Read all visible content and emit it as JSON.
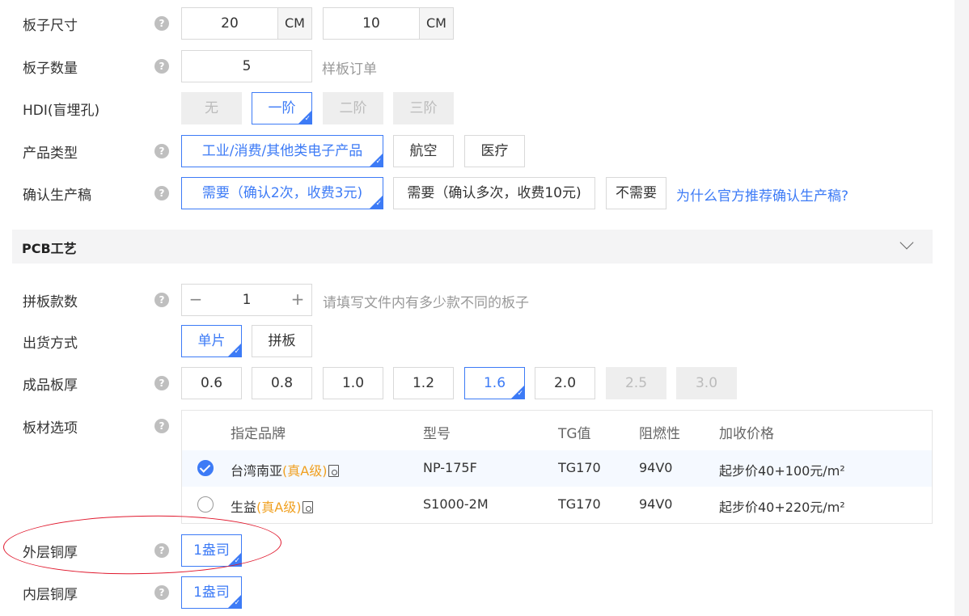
{
  "board_size": {
    "label": "板子尺寸",
    "width": "20",
    "height": "10",
    "unit": "CM"
  },
  "board_qty": {
    "label": "板子数量",
    "value": "5",
    "hint": "样板订单"
  },
  "hdi": {
    "label": "HDI(盲埋孔)",
    "options": [
      "无",
      "一阶",
      "二阶",
      "三阶"
    ]
  },
  "product_type": {
    "label": "产品类型",
    "options": [
      "工业/消费/其他类电子产品",
      "航空",
      "医疗"
    ]
  },
  "confirm": {
    "label": "确认生产稿",
    "options": [
      "需要（确认2次，收费3元)",
      "需要（确认多次，收费10元)",
      "不需要"
    ],
    "link": "为什么官方推荐确认生产稿?"
  },
  "section": {
    "title": "PCB工艺"
  },
  "panel_count": {
    "label": "拼板款数",
    "minus": "−",
    "value": "1",
    "plus": "+",
    "hint": "请填写文件内有多少款不同的板子"
  },
  "ship": {
    "label": "出货方式",
    "options": [
      "单片",
      "拼板"
    ]
  },
  "thickness": {
    "label": "成品板厚",
    "options": [
      "0.6",
      "0.8",
      "1.0",
      "1.2",
      "1.6",
      "2.0",
      "2.5",
      "3.0"
    ]
  },
  "material": {
    "label": "板材选项",
    "headers": [
      "指定品牌",
      "型号",
      "TG值",
      "阻燃性",
      "加收价格"
    ],
    "rows": [
      {
        "brand": "台湾南亚",
        "grade": "(真A级)",
        "model": "NP-175F",
        "tg": "TG170",
        "flame": "94V0",
        "price": "起步价40+100元/m²"
      },
      {
        "brand": "生益",
        "grade": "(真A级)",
        "model": "S1000-2M",
        "tg": "TG170",
        "flame": "94V0",
        "price": "起步价40+220元/m²"
      }
    ]
  },
  "outer_copper": {
    "label": "外层铜厚",
    "value": "1盎司"
  },
  "inner_copper": {
    "label": "内层铜厚",
    "value": "1盎司"
  },
  "help_glyph": "?"
}
